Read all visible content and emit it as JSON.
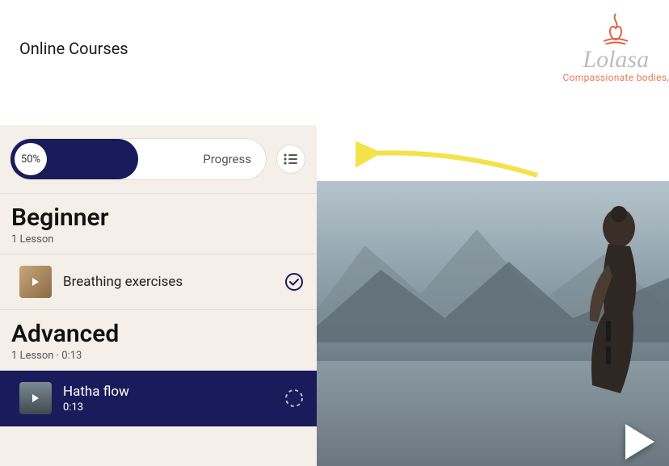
{
  "header": {
    "title": "Online Courses"
  },
  "brand": {
    "name": "Lolasa",
    "tagline": "Compassionate bodies,"
  },
  "progress": {
    "percent_label": "50%",
    "label": "Progress",
    "fill_pct": 50
  },
  "sections": [
    {
      "title": "Beginner",
      "meta": "1 Lesson",
      "lessons": [
        {
          "title": "Breathing exercises",
          "duration": "",
          "completed": true,
          "active": false
        }
      ]
    },
    {
      "title": "Advanced",
      "meta": "1 Lesson · 0:13",
      "lessons": [
        {
          "title": "Hatha flow",
          "duration": "0:13",
          "completed": false,
          "active": true
        }
      ]
    }
  ]
}
